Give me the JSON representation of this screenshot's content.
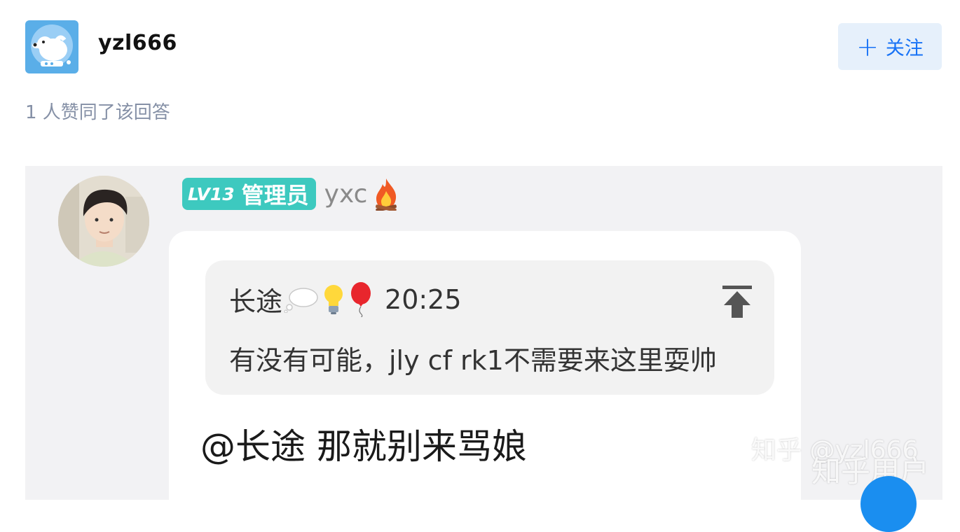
{
  "author": {
    "name": "yzl666"
  },
  "follow": {
    "label": "关注"
  },
  "votes": {
    "text": "1 人赞同了该回答"
  },
  "screenshot": {
    "poster": {
      "level": "LV13",
      "role": "管理员",
      "name": "yxc"
    },
    "quote": {
      "author": "长途",
      "time": "20:25",
      "text": "有没有可能，jly cf rk1不需要来这里耍帅"
    },
    "reply": "@长途 那就别来骂娘"
  },
  "watermark": {
    "line1": "知乎 @yzl666",
    "line2": "知乎用户"
  },
  "icons": [
    "dog-avatar-icon",
    "plus-icon",
    "fire-icon",
    "thought-bubble-icon",
    "lightbulb-icon",
    "balloon-icon",
    "pin-to-top-icon"
  ],
  "colors": {
    "accent": "#1772f6",
    "badge": "#3dc9bf",
    "muted": "#8590a6"
  }
}
